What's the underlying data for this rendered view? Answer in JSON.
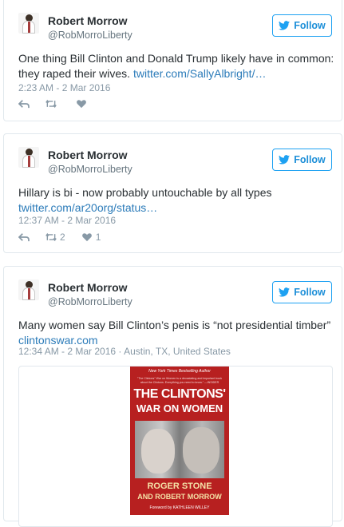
{
  "follow_label": "Follow",
  "brand_color": "#1da1f2",
  "tweets": [
    {
      "author": "Robert Morrow",
      "handle": "@RobMorroLiberty",
      "text": "One thing Bill Clinton and Donald Trump likely have in common: they raped their wives.",
      "link": "twitter.com/SallyAlbright/…",
      "timestamp": "2:23 AM - 2 Mar 2016",
      "retweets": "",
      "likes": ""
    },
    {
      "author": "Robert Morrow",
      "handle": "@RobMorroLiberty",
      "text": "Hillary is bi - now probably untouchable by all types",
      "link": "twitter.com/ar20org/status…",
      "timestamp": "12:37 AM - 2 Mar 2016",
      "retweets": "2",
      "likes": "1"
    },
    {
      "author": "Robert Morrow",
      "handle": "@RobMorroLiberty",
      "text": "Many women say Bill Clinton’s penis is “not presidential timber”",
      "link": "clintonswar.com",
      "timestamp": "12:34 AM - 2 Mar 2016 · Austin, TX, United States",
      "retweets": "",
      "likes": ""
    }
  ],
  "book": {
    "topline": "New York Times Bestselling Author",
    "blurb": "\"The Clintons\" War on Women is a devastating and important book about the Clintons. Everything you need to know.\" —INSIDER",
    "title_line1": "THE CLINTONS'",
    "title_line2": "WAR ON WOMEN",
    "author_line1": "ROGER STONE",
    "author_line2": "AND ROBERT MORROW",
    "foreword": "Foreword by KATHLEEN WILLEY"
  }
}
